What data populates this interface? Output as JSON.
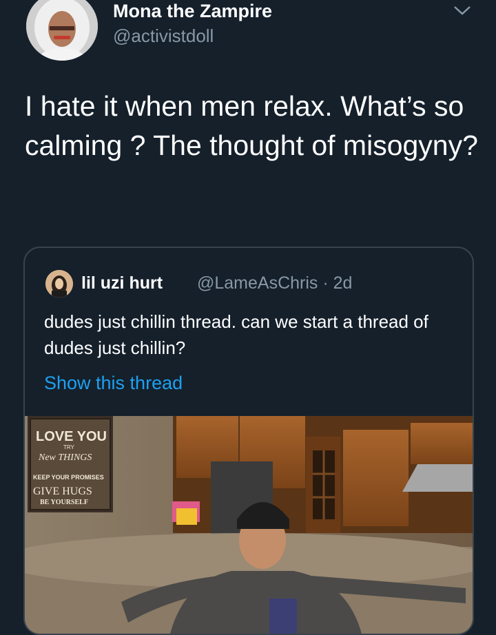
{
  "tweet": {
    "display_name": "Mona the Zampire",
    "handle": "@activistdoll",
    "text": "I hate it when men relax. What’s so calming ? The thought of misogyny?",
    "avatar_icon": "user-avatar",
    "menu_icon": "chevron-down-icon"
  },
  "quoted_tweet": {
    "display_name": "lil uzi hurt",
    "handle_time": "@LameAsChris · 2d",
    "text": "dudes just chillin thread. can we start a thread of dudes just chillin?",
    "show_thread_label": "Show this thread",
    "media": {
      "sign_lines": [
        "LOVE YOU",
        "TRY",
        "New THINGS",
        "KEEP YOUR PROMISES",
        "GIVE HUGS",
        "BE YOURSELF"
      ]
    }
  },
  "colors": {
    "background": "#15202b",
    "secondary_text": "#8899a6",
    "link": "#1da1f2",
    "border": "#38444d"
  }
}
